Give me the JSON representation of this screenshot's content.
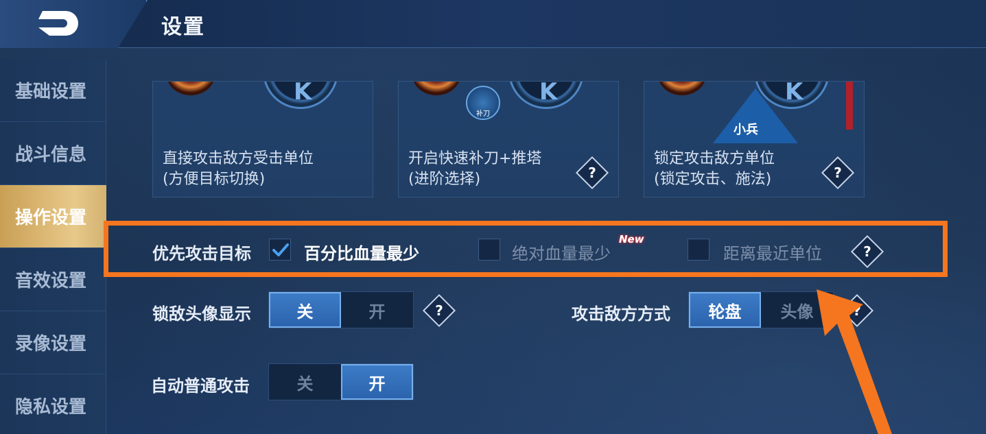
{
  "header": {
    "title": "设置"
  },
  "sidebar": {
    "items": [
      {
        "label": "基础设置",
        "active": false
      },
      {
        "label": "战斗信息",
        "active": false
      },
      {
        "label": "操作设置",
        "active": true
      },
      {
        "label": "音效设置",
        "active": false
      },
      {
        "label": "录像设置",
        "active": false
      },
      {
        "label": "隐私设置",
        "active": false
      }
    ]
  },
  "cards": [
    {
      "title": "直接攻击敌方受击单位",
      "subtitle": "(方便目标切换)",
      "has_help": false
    },
    {
      "title": "开启快速补刀+推塔",
      "subtitle": "(进阶选择)",
      "has_help": true,
      "icon_text": "补刀"
    },
    {
      "title": "锁定攻击敌方单位",
      "subtitle": "(锁定攻击、施法)",
      "has_help": true,
      "icon_text": "小兵"
    }
  ],
  "card_orb_glyph": "K",
  "priority": {
    "label": "优先攻击目标",
    "options": [
      {
        "label": "百分比血量最少",
        "checked": true
      },
      {
        "label": "绝对血量最少",
        "checked": false,
        "badge": "New"
      },
      {
        "label": "距离最近单位",
        "checked": false
      }
    ]
  },
  "lock_avatar": {
    "label": "锁敌头像显示",
    "off": "关",
    "on": "开",
    "selected": "off"
  },
  "attack_mode": {
    "label": "攻击敌方方式",
    "opt1": "轮盘",
    "opt2": "头像",
    "selected": "opt1"
  },
  "auto_attack": {
    "label": "自动普通攻击",
    "off": "关",
    "on": "开",
    "selected": "on"
  },
  "help_glyph": "?",
  "colors": {
    "accent": "#f5761f",
    "selected_toggle": "#3d7bc6",
    "active_tab": "#e8c98a",
    "background": "#1b3352"
  },
  "icons": [
    "back-arrow-icon",
    "checkmark-icon",
    "help-icon",
    "pointer-arrow-icon"
  ]
}
